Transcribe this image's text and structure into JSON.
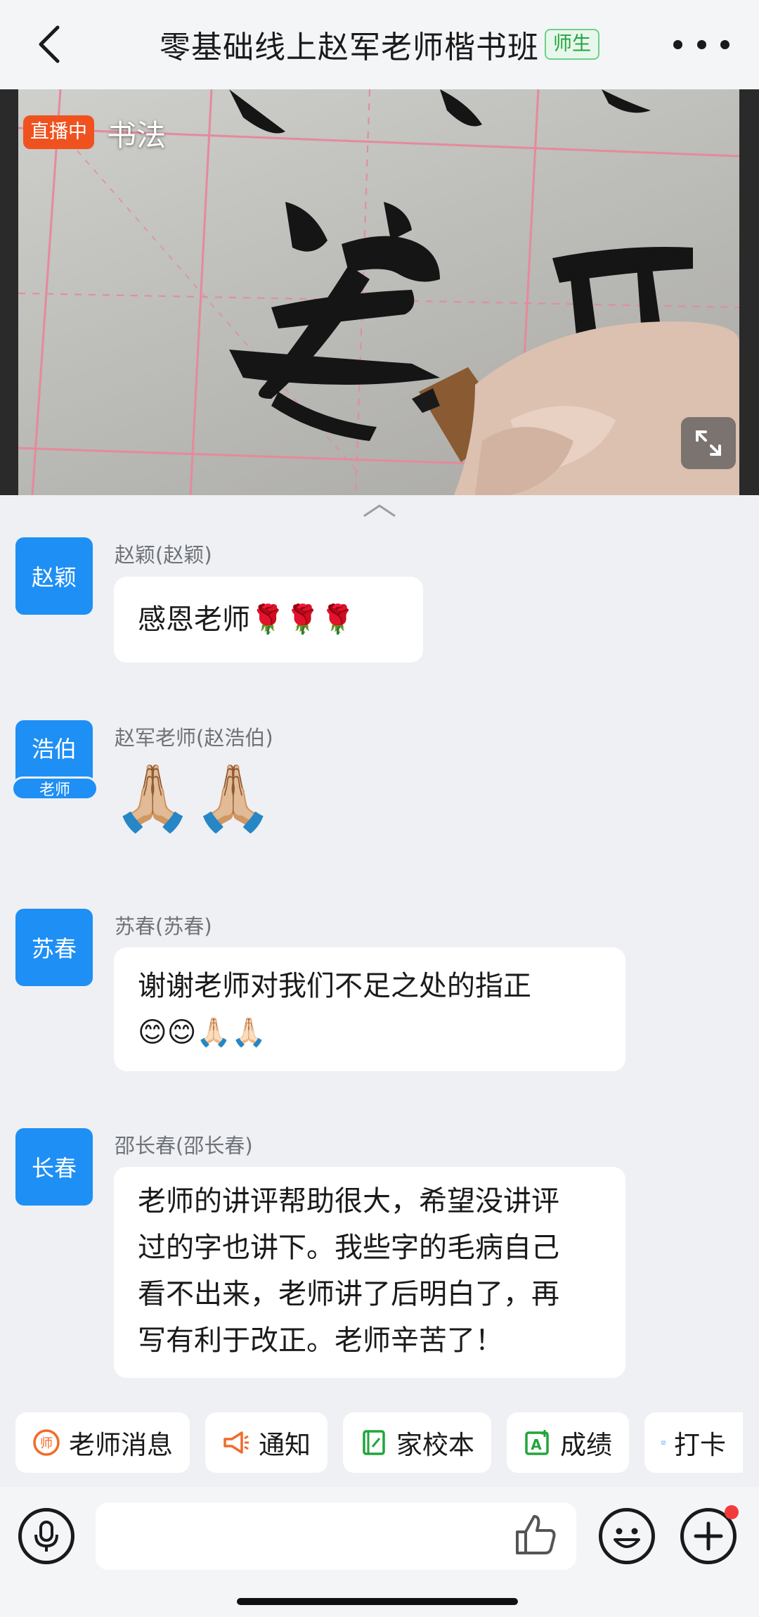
{
  "header": {
    "title": "零基础线上赵军老师楷书班",
    "badge": "师生",
    "icons": [
      "back-icon",
      "more-icon"
    ]
  },
  "live": {
    "status_badge": "直播中",
    "title": "书法"
  },
  "messages": [
    {
      "avatar": "赵颖",
      "sender": "赵颖(赵颖)",
      "text": "感恩老师🌹🌹🌹"
    },
    {
      "avatar": "浩伯",
      "avatar_tag": "老师",
      "sender": "赵军老师(赵浩伯)",
      "text": "🙏🏼🙏🏼"
    },
    {
      "avatar": "苏春",
      "sender": "苏春(苏春)",
      "text_line1": "谢谢老师对我们不足之处的指正",
      "text_line2": "😊😊🙏🏻🙏🏻"
    },
    {
      "avatar": "长春",
      "sender": "邵长春(邵长春)",
      "lines": [
        "老师的讲评帮助很大，希望没讲评",
        "过的字也讲下。我些字的毛病自己",
        "看不出来，老师讲了后明白了，再",
        "写有利于改正。老师辛苦了！"
      ]
    }
  ],
  "quickbar": [
    {
      "label": "老师消息",
      "icon": "teacher-icon",
      "color": "#f26a2a"
    },
    {
      "label": "通知",
      "icon": "megaphone-icon",
      "color": "#f26a2a"
    },
    {
      "label": "家校本",
      "icon": "notebook-icon",
      "color": "#22a53c"
    },
    {
      "label": "成绩",
      "icon": "score-icon",
      "color": "#22a53c"
    },
    {
      "label": "打卡",
      "icon": "calendar-check-icon",
      "color": "#1e8ff5"
    }
  ],
  "inputbar": {
    "icons": [
      "microphone-icon",
      "thumbs-up-icon",
      "emoji-icon",
      "plus-icon"
    ]
  }
}
